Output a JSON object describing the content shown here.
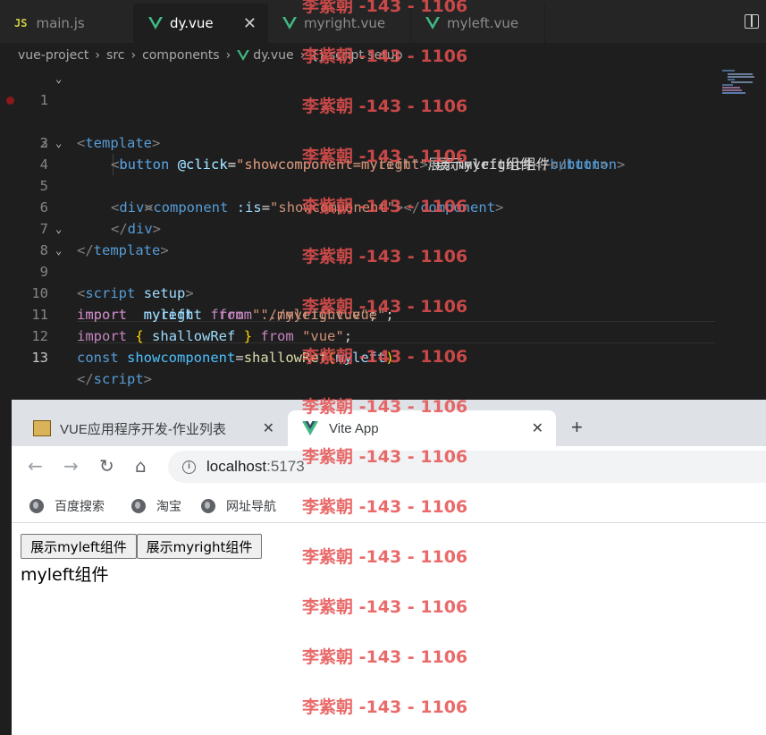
{
  "editor": {
    "tabs": [
      {
        "label": "main.js",
        "icon": "js"
      },
      {
        "label": "dy.vue",
        "icon": "vue"
      },
      {
        "label": "myright.vue",
        "icon": "vue"
      },
      {
        "label": "myleft.vue",
        "icon": "vue"
      }
    ],
    "close_glyph": "✕",
    "js_badge": "JS",
    "breadcrumb": [
      "vue-project",
      "src",
      "components",
      "dy.vue",
      "script setup"
    ],
    "breadcrumb_braces": "{}",
    "breadcrumb_sep": "›",
    "fold_glyph": "⌄",
    "line_numbers": [
      "1",
      "2",
      "3",
      "4",
      "5",
      "6",
      "7",
      "8",
      "9",
      "10",
      "11",
      "12",
      "13"
    ],
    "code": {
      "l1": [
        "<",
        "template",
        ">"
      ],
      "l2": [
        "<",
        "button",
        "@click",
        "=",
        "\"",
        "showcomponent=myleft",
        "\"",
        ">",
        "展示myleft组件",
        "</",
        "button",
        ">"
      ],
      "l3": [
        "<",
        "button",
        "@click",
        "=",
        "\"",
        "showcomponent=myright",
        "\"",
        ">",
        "展示myright组件",
        "</",
        "button",
        ">"
      ],
      "l4": [
        "<",
        "div",
        ">"
      ],
      "l5": [
        "<",
        "component",
        ":is",
        "=",
        "\"",
        "showcomponent",
        "\"",
        "></",
        "component",
        ">"
      ],
      "l6": [
        "</",
        "div",
        ">"
      ],
      "l7": [
        "</",
        "template",
        ">"
      ],
      "l8": [
        "<",
        "script",
        "setup",
        ">"
      ],
      "l9": [
        "import",
        "myleft",
        "from",
        "\"./myleft.vue\"",
        ";"
      ],
      "l10": [
        "import",
        "myright",
        "from",
        "\"./myright.vue\"",
        ";"
      ],
      "l11": [
        "import",
        "{",
        "shallowRef",
        "}",
        "from",
        "\"vue\"",
        ";"
      ],
      "l12": [
        "const",
        "showcomponent",
        "=",
        "shallowRef",
        "(",
        "myleft",
        ")"
      ],
      "l13": [
        "</",
        "script",
        ">"
      ]
    }
  },
  "browser": {
    "tabs": [
      {
        "title": "VUE应用程序开发-作业列表"
      },
      {
        "title": "Vite App"
      }
    ],
    "close_glyph": "✕",
    "new_tab_glyph": "+",
    "nav": {
      "back": "←",
      "forward": "→",
      "reload": "↻",
      "home": "⌂"
    },
    "address": {
      "host": "localhost",
      "port": ":5173"
    },
    "bookmarks": [
      "百度搜索",
      "淘宝",
      "网址导航"
    ],
    "page": {
      "buttons": [
        "展示myleft组件",
        "展示myright组件"
      ],
      "component_text": "myleft组件"
    }
  },
  "watermark": "李紫朝 -143 - 1106",
  "colors": {
    "vue_green": "#41b883",
    "vue_dark": "#35495e",
    "editor_bg": "#1e1e1e"
  }
}
